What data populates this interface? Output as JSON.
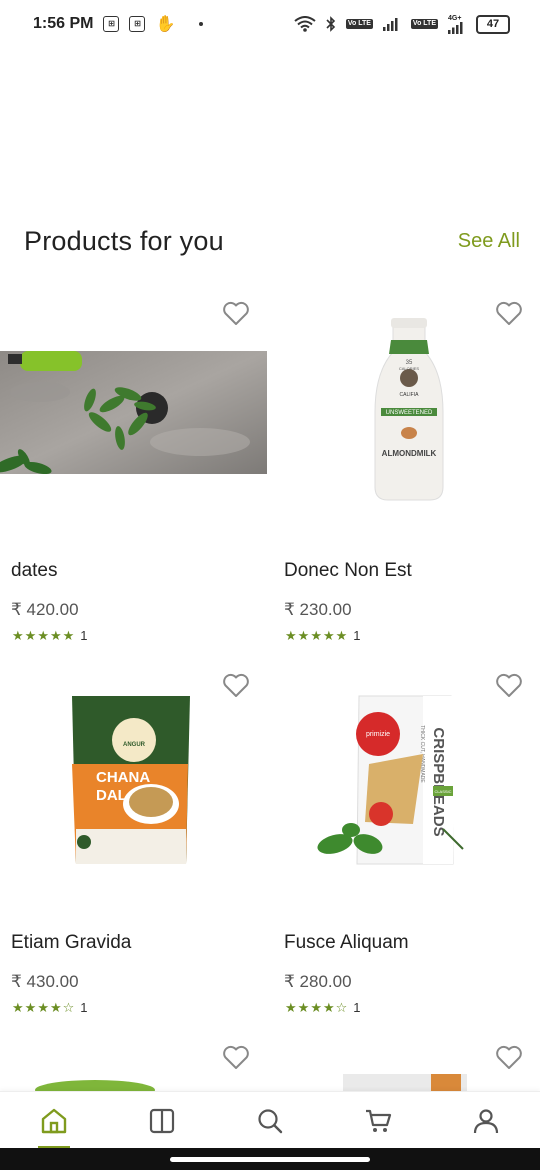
{
  "status_bar": {
    "time": "1:56 PM",
    "battery": "47",
    "network_label": "4G+",
    "volte_label": "Vo LTE"
  },
  "section": {
    "title": "Products for you",
    "see_all": "See All"
  },
  "products": [
    {
      "name": "dates",
      "price": "₹ 420.00",
      "rating_count": "1",
      "stars": 5
    },
    {
      "name": "Donec Non Est",
      "price": "₹ 230.00",
      "rating_count": "1",
      "stars": 5
    },
    {
      "name": "Etiam Gravida",
      "price": "₹ 430.00",
      "rating_count": "1",
      "stars": 4
    },
    {
      "name": "Fusce Aliquam",
      "price": "₹ 280.00",
      "rating_count": "1",
      "stars": 4
    }
  ],
  "product_images": {
    "almond": {
      "brand": "CALIFIA",
      "calories": "35",
      "calories_label": "CALORIES",
      "tag": "UNSWEETENED",
      "label": "ALMONDMILK"
    },
    "chana": {
      "brand": "ANGUR",
      "title_line1": "CHANA",
      "title_line2": "DAL"
    },
    "crisp": {
      "brand": "primizie",
      "label": "CRISPBREADS",
      "sub": "THICK CUT, HANDMADE",
      "flavor": "CLASSIC"
    }
  },
  "bottom_nav": {
    "items": [
      "home",
      "catalog",
      "search",
      "cart",
      "account"
    ],
    "active": "home"
  },
  "colors": {
    "accent": "#7f9b1e",
    "star": "#6b8e23"
  }
}
